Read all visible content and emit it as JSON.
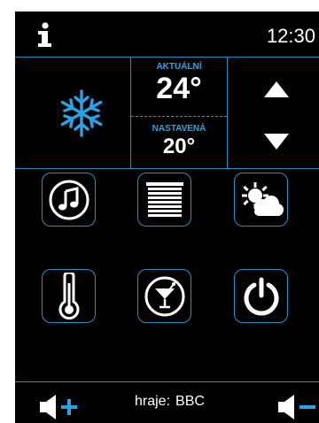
{
  "header": {
    "time": "12:30",
    "info_icon": "info-icon"
  },
  "climate": {
    "mode_icon": "snowflake-icon",
    "actual_label": "AKTUÁLNÍ",
    "actual_value": "24°",
    "set_label": "NASTAVENÁ",
    "set_value": "20°"
  },
  "tiles": [
    {
      "icon": "music-icon"
    },
    {
      "icon": "blinds-icon"
    },
    {
      "icon": "weather-icon"
    },
    {
      "icon": "thermometer-icon"
    },
    {
      "icon": "cocktail-icon"
    },
    {
      "icon": "power-icon"
    }
  ],
  "footer": {
    "playing_label": "hraje:",
    "playing_value": "BBC"
  },
  "colors": {
    "accent": "#2aa3e6",
    "line": "#2a8fc0",
    "background": "#000000",
    "text": "#ffffff"
  }
}
